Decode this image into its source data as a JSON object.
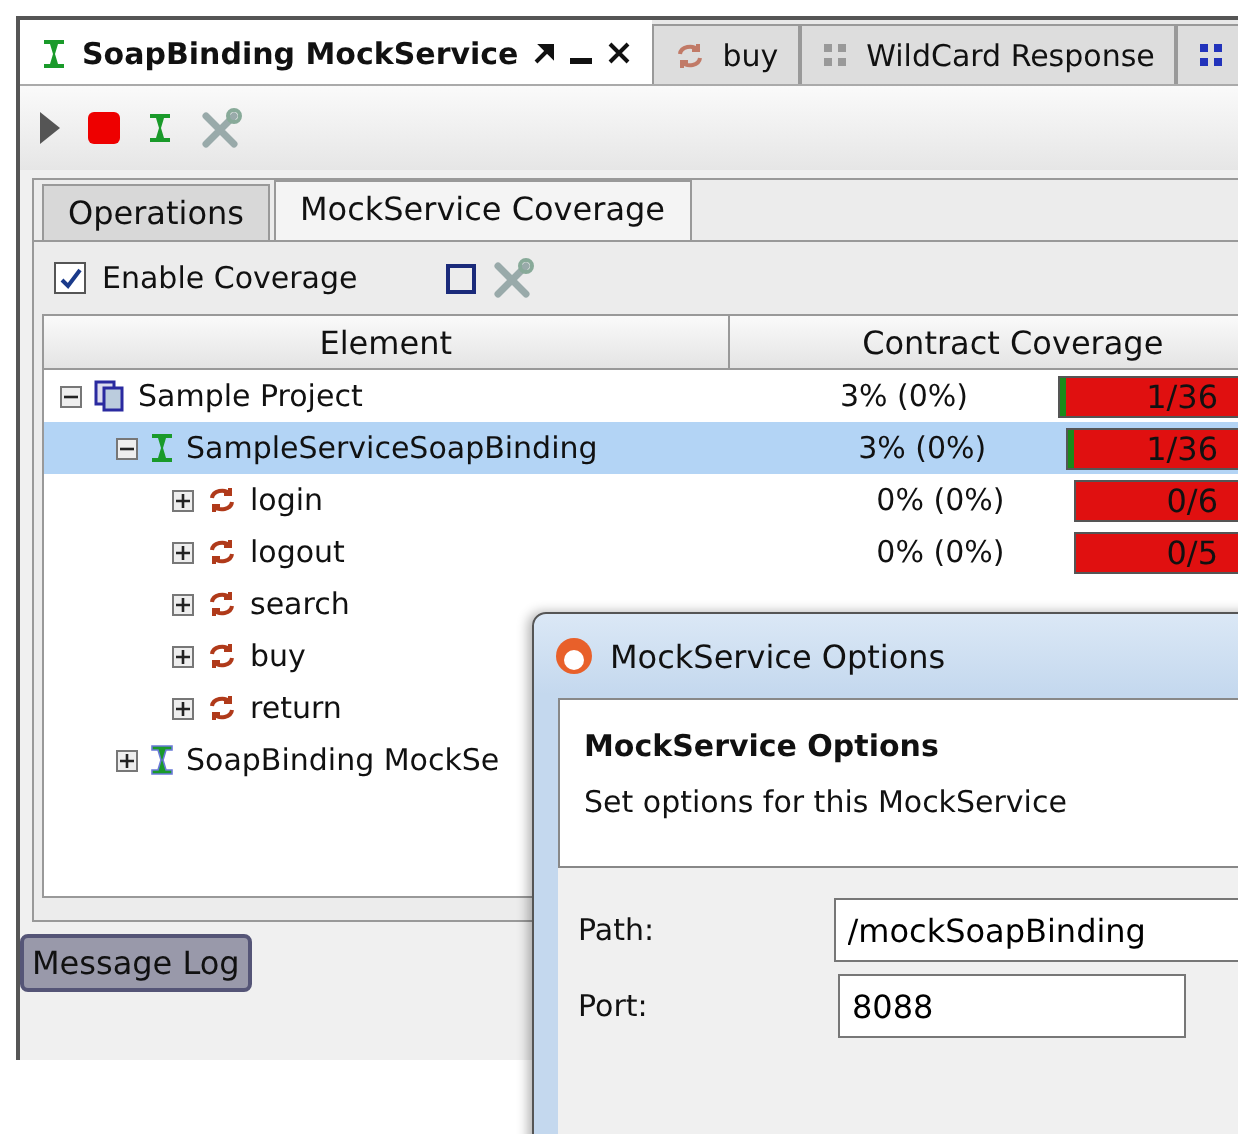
{
  "editor_tabs": [
    {
      "label": "SoapBinding MockService",
      "kind": "mock",
      "selected": true
    },
    {
      "label": "buy",
      "kind": "operation",
      "selected": false
    },
    {
      "label": "WildCard Response",
      "kind": "soap",
      "selected": false
    },
    {
      "kind": "soap-cut",
      "selected": false
    }
  ],
  "toolbar": {
    "tools": [
      {
        "kind": "run"
      },
      {
        "kind": "stop"
      },
      {
        "kind": "mock"
      },
      {
        "kind": "options"
      }
    ]
  },
  "inner_tabs": [
    {
      "label": "Operations",
      "selected": false
    },
    {
      "label": "MockService Coverage",
      "selected": true
    }
  ],
  "coverage_toolbar": {
    "enable_coverage": {
      "label": "Enable Coverage",
      "checked": true
    }
  },
  "table": {
    "columns": [
      "Element",
      "Contract Coverage"
    ],
    "rows": [
      {
        "name": "Sample Project",
        "kind": "project",
        "expanded": true,
        "selected": false,
        "coverage": "3% (0%)",
        "bar": "1/36",
        "level": 0.03,
        "children": [
          {
            "name": "SampleServiceSoapBinding",
            "kind": "interface",
            "expanded": true,
            "selected": true,
            "coverage": "3% (0%)",
            "bar": "1/36",
            "level": 0.03,
            "children": [
              {
                "name": "login",
                "kind": "operation",
                "expanded": false,
                "selected": false,
                "coverage": "0% (0%)",
                "bar": "0/6",
                "level": 0
              },
              {
                "name": "logout",
                "kind": "operation",
                "expanded": false,
                "selected": false,
                "coverage": "0% (0%)",
                "bar": "0/5",
                "level": 0
              },
              {
                "name": "search",
                "kind": "operation",
                "expanded": false,
                "selected": false
              },
              {
                "name": "buy",
                "kind": "operation",
                "expanded": false,
                "selected": false
              },
              {
                "name": "return",
                "kind": "operation",
                "expanded": false,
                "selected": false
              }
            ]
          },
          {
            "name": "SoapBinding MockSe",
            "kind": "mock",
            "expanded": false,
            "selected": false
          }
        ]
      }
    ]
  },
  "bottom_tabs": [
    {
      "label": "Message Log"
    }
  ],
  "dialog": {
    "title": "MockService Options",
    "heading": "MockService Options",
    "description": "Set options for this MockService",
    "fields": [
      {
        "label": "Path:",
        "value": "/mockSoapBinding"
      },
      {
        "label": "Port:",
        "value": "8088"
      }
    ]
  }
}
